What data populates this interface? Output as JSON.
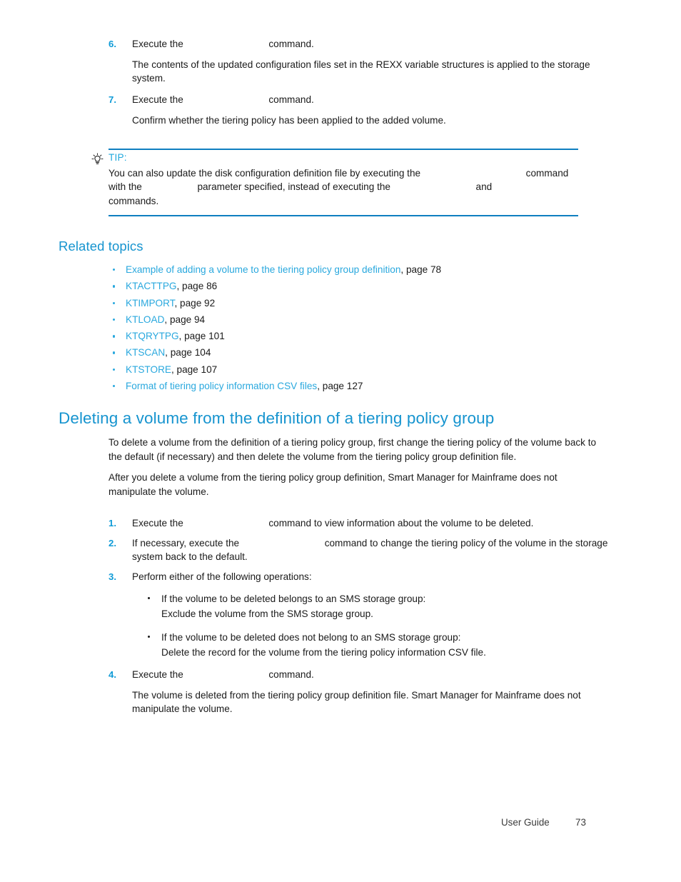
{
  "document": {
    "footer_label": "User Guide",
    "page_number": "73"
  },
  "colors": {
    "accent_blue": "#29a8de",
    "heading_blue": "#1694cf",
    "rule_blue": "#0f7fc0",
    "body_black": "#1a1a1a"
  },
  "top_procedure": {
    "steps": [
      {
        "number": "6.",
        "text_before": "Execute the",
        "command": "",
        "text_after": "command.",
        "paragraph": "The contents of the updated configuration files set in the REXX variable structures is applied to the storage system."
      },
      {
        "number": "7.",
        "text_before": "Execute the",
        "command": "",
        "text_after": "command.",
        "paragraph": "Confirm whether the tiering policy has been applied to the added volume."
      }
    ]
  },
  "tip": {
    "icon": "lightbulb-icon",
    "label": "TIP:",
    "line1_a": "You can also update the disk configuration definition file by executing the",
    "line1_cmd": "",
    "line1_b": "command with",
    "line2_a": "the",
    "line2_cmd1": "",
    "line2_b": "parameter specified, instead of executing the",
    "line2_cmd2": "",
    "line2_c": "and",
    "line2_cmd3": "",
    "line2_d": "commands."
  },
  "related_topics": {
    "heading": "Related topics",
    "items": [
      {
        "link": "Example of adding a volume to the tiering policy group definition",
        "page": ", page 78"
      },
      {
        "link": "KTACTTPG",
        "page": ", page 86"
      },
      {
        "link": "KTIMPORT",
        "page": ", page 92"
      },
      {
        "link": "KTLOAD",
        "page": ", page 94"
      },
      {
        "link": "KTQRYTPG",
        "page": ", page 101"
      },
      {
        "link": "KTSCAN",
        "page": ", page 104"
      },
      {
        "link": "KTSTORE",
        "page": ", page 107"
      },
      {
        "link": "Format of tiering policy information CSV files",
        "page": ", page 127"
      }
    ]
  },
  "section": {
    "heading": "Deleting a volume from the definition of a tiering policy group",
    "intro_1": "To delete a volume from the definition of a tiering policy group, first change the tiering policy of the volume back to the default (if necessary) and then delete the volume from the tiering policy group definition file.",
    "intro_2": "After you delete a volume from the tiering policy group definition, Smart Manager for Mainframe does not manipulate the volume.",
    "steps": {
      "s1_num": "1.",
      "s1_a": "Execute the",
      "s1_cmd": "",
      "s1_b": "command to view information about the volume to be deleted.",
      "s2_num": "2.",
      "s2_a": "If necessary, execute the",
      "s2_cmd": "",
      "s2_b": "command to change the tiering policy of the volume in the storage system back to the default.",
      "s3_num": "3.",
      "s3_text": "Perform either of the following operations:",
      "s3_sub": [
        {
          "line1": "If the volume to be deleted belongs to an SMS storage group:",
          "line2": "Exclude the volume from the SMS storage group."
        },
        {
          "line1": "If the volume to be deleted does not belong to an SMS storage group:",
          "line2": "Delete the record for the volume from the tiering policy information CSV file."
        }
      ],
      "s4_num": "4.",
      "s4_a": "Execute the",
      "s4_cmd": "",
      "s4_b": "command.",
      "s4_para": "The volume is deleted from the tiering policy group definition file. Smart Manager for Mainframe does not manipulate the volume."
    }
  }
}
